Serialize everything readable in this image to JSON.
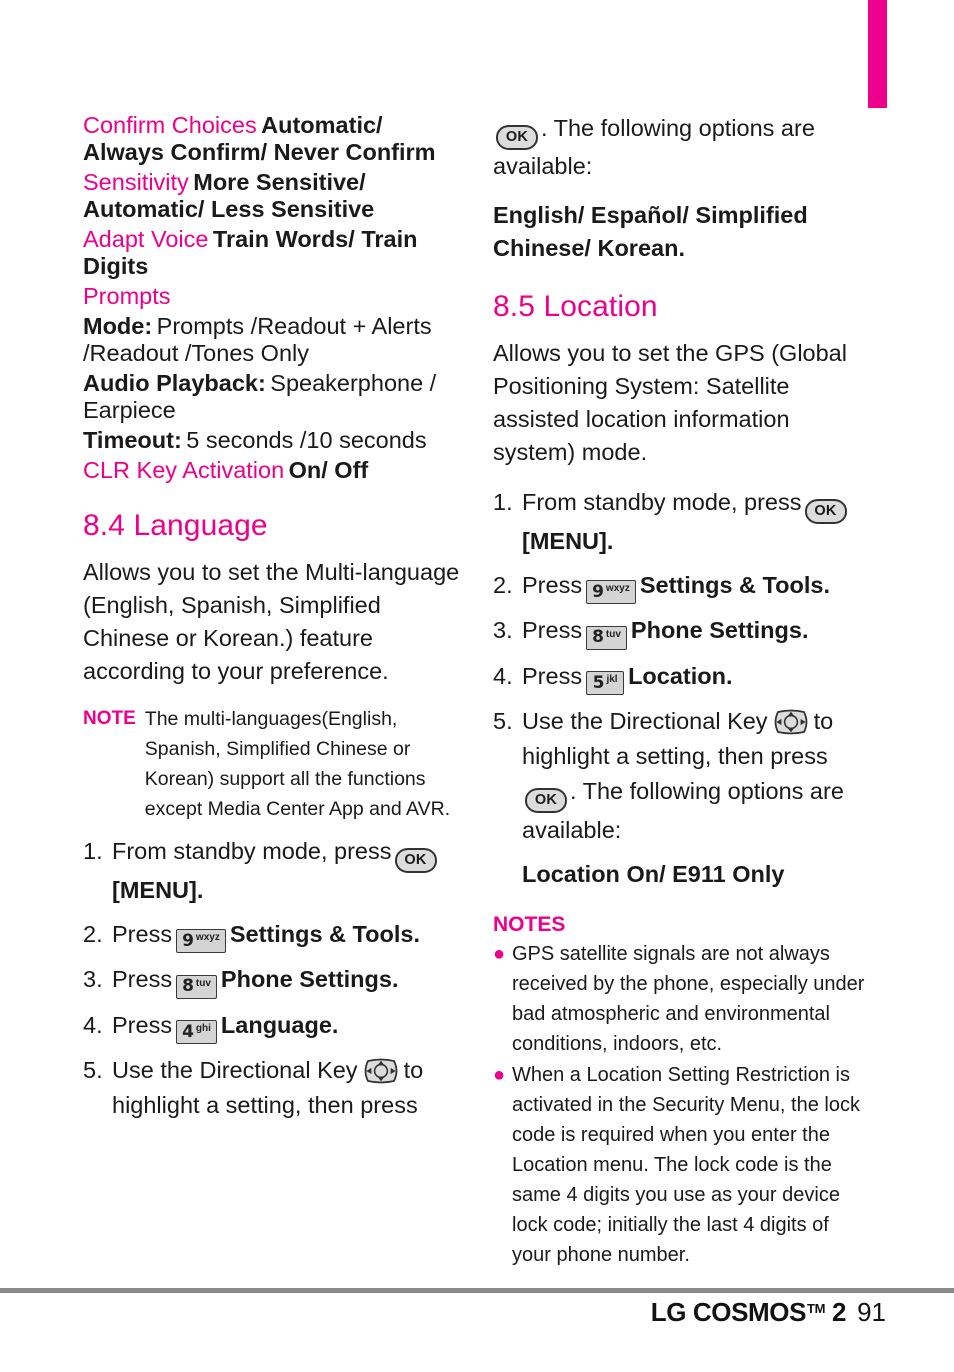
{
  "page": {
    "number": "91",
    "brand": "LG COSMOS",
    "trademark": "TM",
    "model": "2",
    "tab_color": "#ec008c",
    "accent_color": "#ec008c"
  },
  "icons": {
    "ok": {
      "label": "OK",
      "name": "ok-key-icon"
    },
    "directional": {
      "name": "directional-key-icon"
    },
    "key9": {
      "digit": "9",
      "letters": "wxyz"
    },
    "key8": {
      "digit": "8",
      "letters": "tuv"
    },
    "key5": {
      "digit": "5",
      "letters": "jkl"
    },
    "key4": {
      "digit": "4",
      "letters": "ghi"
    }
  },
  "left_column": {
    "spec_list": [
      {
        "term": "Confirm Choices",
        "values": "Automatic/ Always Confirm/ Never Confirm"
      },
      {
        "term": "Sensitivity",
        "values": "More Sensitive/ Automatic/ Less Sensitive"
      },
      {
        "term": "Adapt Voice",
        "values": "Train Words/ Train Digits"
      },
      {
        "term": "Prompts",
        "values": ""
      }
    ],
    "prompt_options": [
      {
        "label": "Mode:",
        "values": "Prompts /Readout + Alerts /Readout /Tones Only"
      },
      {
        "label": "Audio Playback:",
        "values": "Speakerphone / Earpiece"
      },
      {
        "label": "Timeout:",
        "values": "5 seconds /10 seconds"
      }
    ],
    "clr_key": {
      "term": "CLR Key Activation",
      "values": "On/ Off"
    },
    "section": {
      "heading": "8.4 Language",
      "intro": "Allows you to set the Multi-language (English, Spanish, Simplified Chinese or Korean.) feature according to your preference."
    },
    "note": {
      "label": "NOTE",
      "text": "The multi-languages(English, Spanish, Simplified Chinese or Korean) support all the functions except Media Center App and AVR."
    },
    "steps": [
      {
        "num": "1.",
        "pre": "From standby mode, press",
        "icon": "ok",
        "post": "[MENU].",
        "post_bold": true
      },
      {
        "num": "2.",
        "pre": "Press",
        "icon": "key9",
        "post": "Settings & Tools.",
        "post_bold": true
      },
      {
        "num": "3.",
        "pre": "Press",
        "icon": "key8",
        "post": "Phone Settings.",
        "post_bold": true
      },
      {
        "num": "4.",
        "pre": "Press",
        "icon": "key4",
        "post": "Language.",
        "post_bold": true
      },
      {
        "num": "5.",
        "pre": "Use the Directional Key",
        "icon": "directional",
        "post": "to highlight a setting, then press",
        "post_bold": false
      }
    ]
  },
  "right_column": {
    "continuation": {
      "pre": "",
      "icon": "ok",
      "text": ". The following options are available:",
      "options": "English/ Español/ Simplified Chinese/ Korean."
    },
    "section": {
      "heading": "8.5 Location",
      "intro": "Allows you to set the GPS (Global Positioning System: Satellite assisted location information system) mode."
    },
    "steps": [
      {
        "num": "1.",
        "pre": "From standby mode, press",
        "icon": "ok",
        "post": "[MENU].",
        "post_bold": true
      },
      {
        "num": "2.",
        "pre": "Press",
        "icon": "key9",
        "post": "Settings & Tools.",
        "post_bold": true
      },
      {
        "num": "3.",
        "pre": "Press",
        "icon": "key8",
        "post": "Phone Settings.",
        "post_bold": true
      },
      {
        "num": "4.",
        "pre": "Press",
        "icon": "key5",
        "post": "Location.",
        "post_bold": true
      },
      {
        "num": "5.",
        "pre": "Use the Directional Key",
        "icon": "directional",
        "mid": "to highlight a setting, then press",
        "icon2": "ok",
        "post": ". The following options are available:",
        "post_bold": false
      }
    ],
    "options_line": "Location On/ E911 Only",
    "notes": {
      "heading": "NOTES",
      "items": [
        "GPS satellite signals are not always received by the phone, especially under bad atmospheric and environmental conditions, indoors, etc.",
        "When a Location Setting Restriction is activated in the Security Menu, the lock code is required when you enter the Location menu. The lock code is the same 4 digits you use as your device lock code; initially the last 4 digits of your phone number."
      ]
    }
  }
}
